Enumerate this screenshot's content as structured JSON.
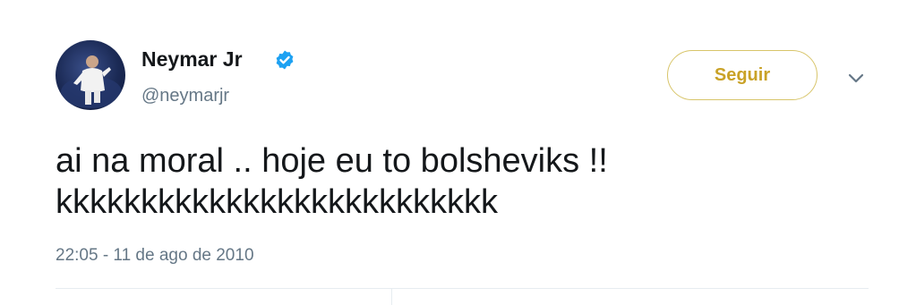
{
  "tweet": {
    "display_name": "Neymar Jr",
    "handle": "@neymarjr",
    "verified": true,
    "follow_label": "Seguir",
    "text_lines": [
      "ai na moral .. hoje eu to bolsheviks !!",
      "kkkkkkkkkkkkkkkkkkkkkkkkkk"
    ],
    "timestamp": "22:05 - 11 de ago de 2010"
  },
  "icons": {
    "verified": "verified-badge-icon",
    "more": "chevron-down-icon",
    "avatar": "profile-photo"
  },
  "colors": {
    "verified_blue": "#1da1f2",
    "follow_accent": "#c9a227",
    "text_primary": "#14171a",
    "text_secondary": "#657786"
  }
}
